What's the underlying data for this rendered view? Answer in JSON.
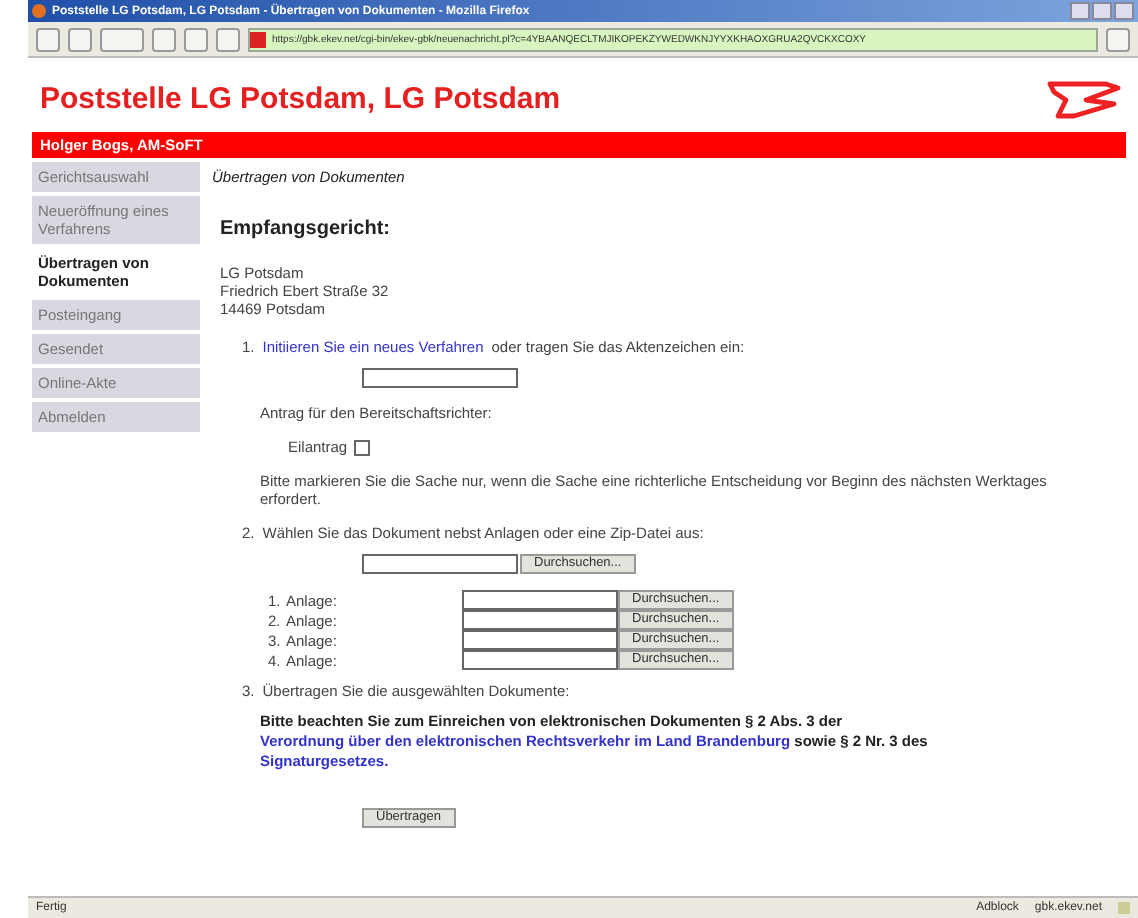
{
  "window": {
    "title": "Poststelle LG Potsdam, LG Potsdam - Übertragen von Dokumenten - Mozilla Firefox"
  },
  "toolbar": {
    "url": "https://gbk.ekev.net/cgi-bin/ekev-gbk/neuenachricht.pl?c=4YBAANQECLTMJIKOPEKZYWEDWKNJYYXKHAOXGRUA2QVCKXCOXY"
  },
  "header": {
    "title": "Poststelle LG Potsdam, LG Potsdam",
    "user": "Holger Bogs, AM-SoFT"
  },
  "sidebar": {
    "items": [
      {
        "label": "Gerichtsauswahl",
        "selected": false
      },
      {
        "label": "Neueröffnung eines Verfahrens",
        "selected": false
      },
      {
        "label": "Übertragen von Dokumenten",
        "selected": true
      },
      {
        "label": "Posteingang",
        "selected": false
      },
      {
        "label": "Gesendet",
        "selected": false
      },
      {
        "label": "Online-Akte",
        "selected": false
      },
      {
        "label": "Abmelden",
        "selected": false
      }
    ]
  },
  "content": {
    "breadcrumb": "Übertragen von Dokumenten",
    "heading": "Empfangsgericht:",
    "address": [
      "LG Potsdam",
      "Friedrich Ebert Straße 32",
      "14469 Potsdam"
    ],
    "step1": {
      "number": "1.",
      "link": "Initiieren Sie ein neues Verfahren",
      "text": "oder tragen Sie das Aktenzeichen ein:"
    },
    "urgent_label": "Antrag für den Bereitschaftsrichter:",
    "urgent": {
      "label": "Eilantrag",
      "checked": false
    },
    "urgent_note": "Bitte markieren Sie die Sache nur, wenn die Sache eine richterliche Entscheidung vor Beginn des nächsten Werktages erfordert.",
    "step2": {
      "number": "2.",
      "text": "Wählen Sie das Dokument nebst Anlagen oder eine Zip-Datei aus:",
      "browse": "Durchsuchen..."
    },
    "attachments": [
      {
        "number": "1.",
        "label": "Anlage:",
        "browse": "Durchsuchen..."
      },
      {
        "number": "2.",
        "label": "Anlage:",
        "browse": "Durchsuchen..."
      },
      {
        "number": "3.",
        "label": "Anlage:",
        "browse": "Durchsuchen..."
      },
      {
        "number": "4.",
        "label": "Anlage:",
        "browse": "Durchsuchen..."
      }
    ],
    "step3": {
      "number": "3.",
      "text": "Übertragen Sie die ausgewählten Dokumente:"
    },
    "notice": [
      {
        "kind": "text",
        "text": "Bitte beachten Sie zum Einreichen von elektronischen Dokumenten § 2 Abs. 3 der"
      },
      {
        "kind": "link",
        "text": "Verordnung über den elektronischen Rechtsverkehr im Land Brandenburg"
      },
      {
        "kind": "text",
        "text": "sowie § 2 Nr. 3 des"
      },
      {
        "kind": "link",
        "text": "Signaturgesetzes."
      }
    ],
    "submit": "Übertragen"
  },
  "status_bar": {
    "left": "Fertig",
    "addon": "Adblock",
    "host": "gbk.ekev.net"
  }
}
